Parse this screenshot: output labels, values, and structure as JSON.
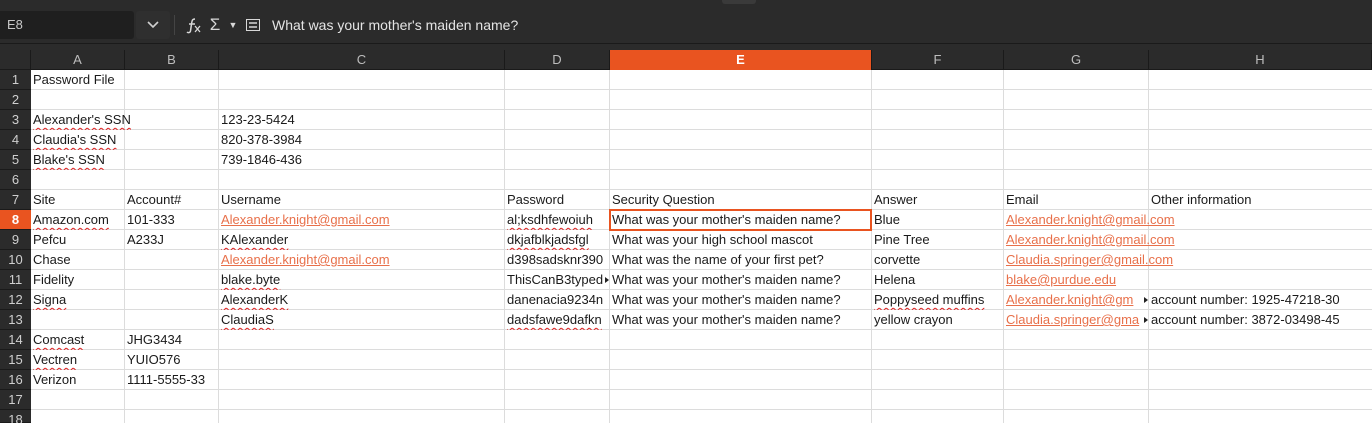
{
  "formula_bar": {
    "cell_ref": "E8",
    "content": "What was your mother's maiden name?",
    "icons": [
      "chevron-down-icon",
      "function-wizard-icon",
      "sum-icon",
      "dropdown-arrow-icon",
      "formula-icon"
    ]
  },
  "colors": {
    "accent": "#e95420",
    "link": "#e8704a",
    "chrome": "#2b2b2b"
  },
  "columns": [
    "A",
    "B",
    "C",
    "D",
    "E",
    "F",
    "G",
    "H"
  ],
  "active_column": "E",
  "rows": [
    "1",
    "2",
    "3",
    "4",
    "5",
    "6",
    "7",
    "8",
    "9",
    "10",
    "11",
    "12",
    "13",
    "14",
    "15",
    "16",
    "17",
    "18"
  ],
  "active_row": "8",
  "cells": {
    "a1": "Password File",
    "a3": "Alexander's SSN",
    "c3": "123-23-5424",
    "a4": "Claudia's SSN",
    "c4": "820-378-3984",
    "a5": "Blake's SSN",
    "c5": "739-1846-436",
    "a7": "Site",
    "b7": "Account#",
    "c7": "Username",
    "d7": "Password",
    "e7": "Security Question",
    "f7": "Answer",
    "g7": "Email",
    "h7": "Other information",
    "a8": "Amazon.com",
    "b8": "101-333",
    "c8": "Alexander.knight@gmail.com",
    "d8": "al;ksdhfewoiuh",
    "e8": "What was your mother's maiden name?",
    "f8": "Blue",
    "g8": "Alexander.knight@gmail.com",
    "a9": "Pefcu",
    "b9": "A233J",
    "c9": "KAlexander",
    "d9": "dkjafblkjadsfgl",
    "e9": "What was your high school mascot",
    "f9": "Pine Tree",
    "g9": "Alexander.knight@gmail.com",
    "a10": "Chase",
    "c10": "Alexander.knight@gmail.com",
    "d10": "d398sadsknr390",
    "e10": "What was the name of your first pet?",
    "f10": "corvette",
    "g10": "Claudia.springer@gmail.com",
    "a11": "Fidelity",
    "c11": "blake.byte",
    "d11": "ThisCanB3typed",
    "e11": "What was your mother's maiden name?",
    "f11": "Helena",
    "g11": "blake@purdue.edu",
    "a12": "Signa",
    "c12": "AlexanderK",
    "d12": "danenacia9234n",
    "e12": "What was your mother's maiden name?",
    "f12": "Poppyseed muffins",
    "g12": "Alexander.knight@gm",
    "h12": "account number: 1925-47218-30",
    "c13": "ClaudiaS",
    "d13": "dadsfawe9dafkn",
    "e13": "What was your mother's maiden name?",
    "f13": "yellow crayon",
    "g13": "Claudia.springer@gma",
    "h13": "account number: 3872-03498-45",
    "a14": "Comcast",
    "b14": "JHG3434",
    "a15": "Vectren",
    "b15": "YUIO576",
    "a16": "Verizon",
    "b16": "1111-5555-33"
  }
}
